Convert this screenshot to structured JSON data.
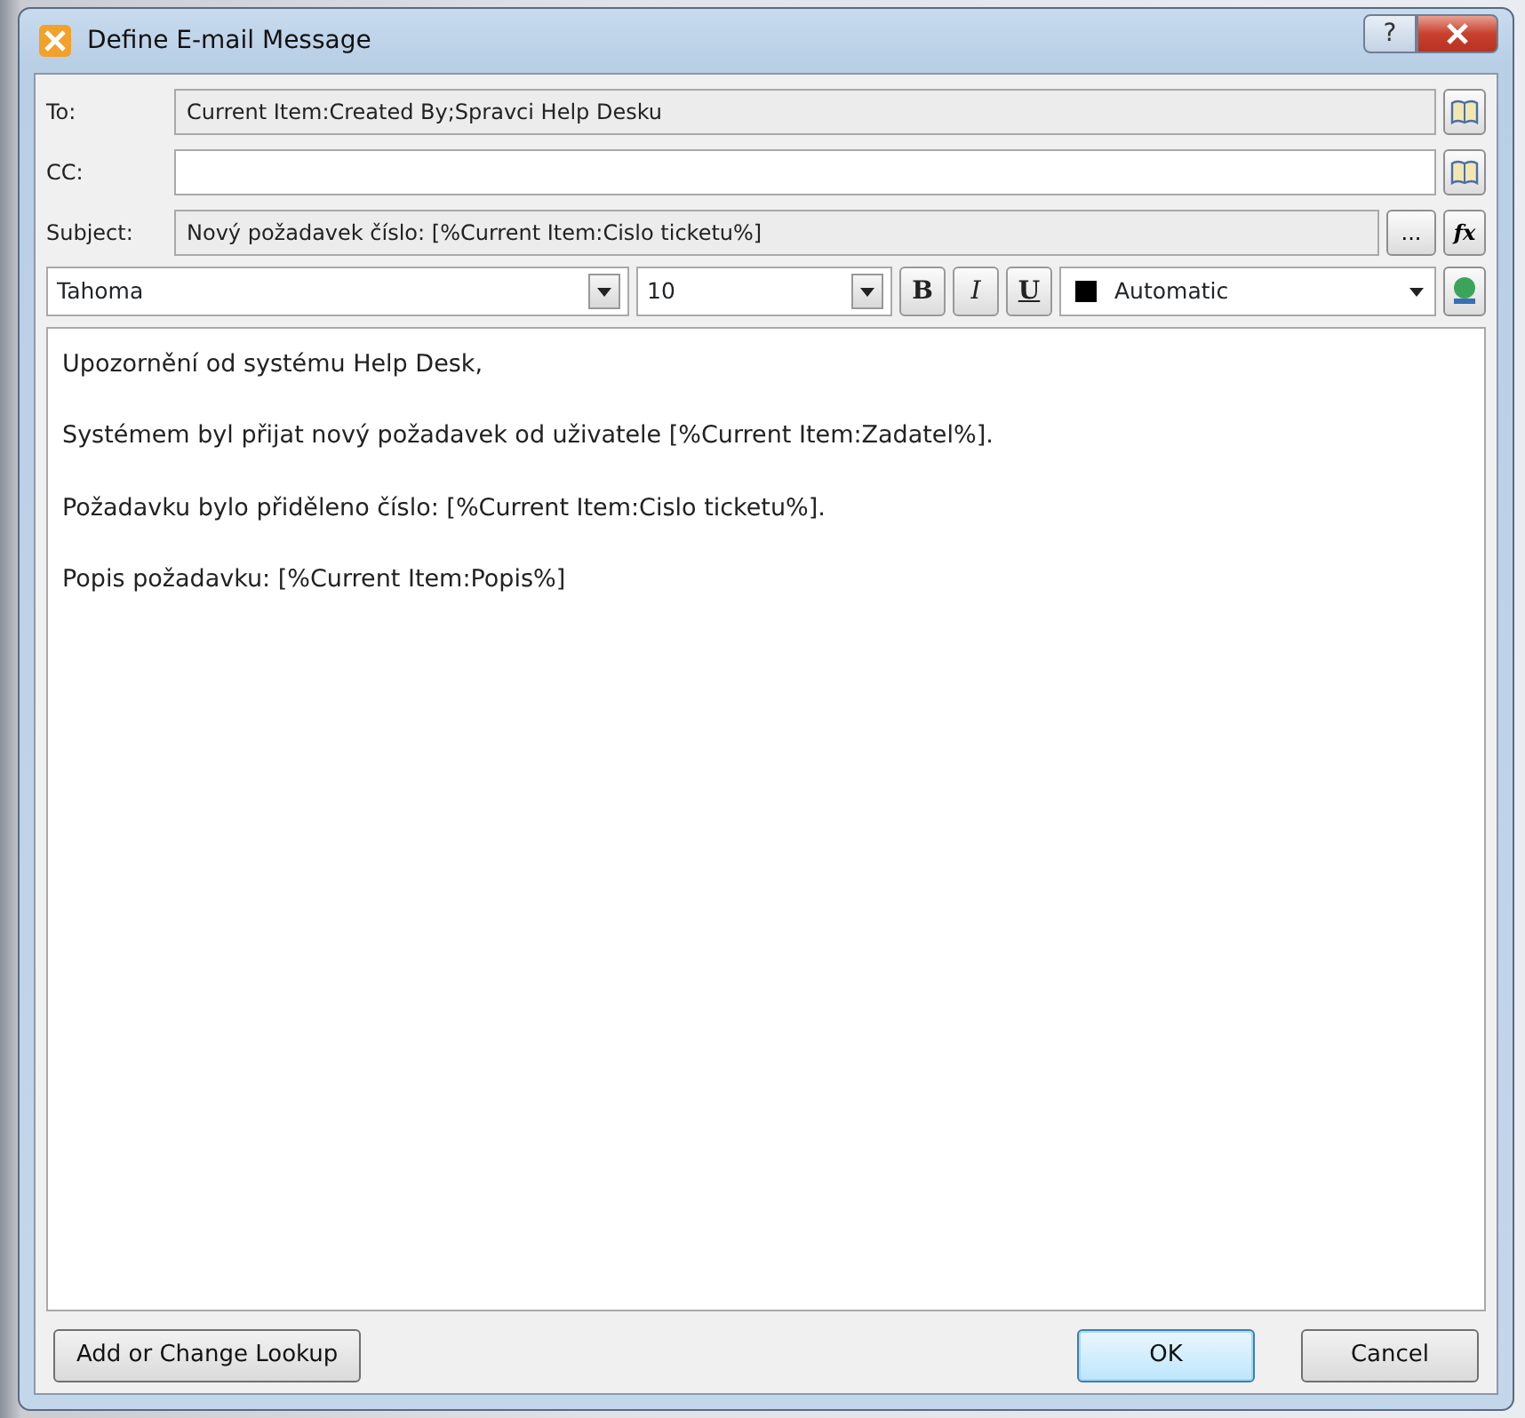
{
  "window": {
    "title": "Define E-mail Message",
    "help_button": "?"
  },
  "fields": [
    {
      "label": "To:",
      "value": "Current Item:Created By;Spravci Help Desku",
      "readonly": true,
      "actions": [
        {
          "kind": "book"
        }
      ]
    },
    {
      "label": "CC:",
      "readonly": false,
      "actions": [
        {
          "kind": "book"
        }
      ]
    },
    {
      "label": "Subject:",
      "value": "Nový požadavek číslo: [%Current Item:Cislo ticketu%]",
      "readonly": true,
      "actions": [
        {
          "kind": "text",
          "label": "..."
        },
        {
          "kind": "formula",
          "label": "fx"
        }
      ]
    }
  ],
  "toolbar": {
    "font": "Tahoma",
    "size": "10",
    "format_buttons": [
      {
        "kind": "bold",
        "label": "B"
      },
      {
        "kind": "italic",
        "label": "I"
      },
      {
        "kind": "underline",
        "label": "U"
      }
    ],
    "color_label": "Automatic"
  },
  "body": [
    "Upozornění od systému Help Desk,",
    "Systémem byl přijat nový požadavek od uživatele [%Current Item:Zadatel%].",
    "Požadavku bylo přiděleno číslo: [%Current Item:Cislo ticketu%].",
    "Popis požadavku: [%Current Item:Popis%]"
  ],
  "buttons": [
    {
      "label": "Add or Change Lookup",
      "default": false
    },
    {
      "label": "OK",
      "default": true
    },
    {
      "label": "Cancel",
      "default": false
    }
  ]
}
